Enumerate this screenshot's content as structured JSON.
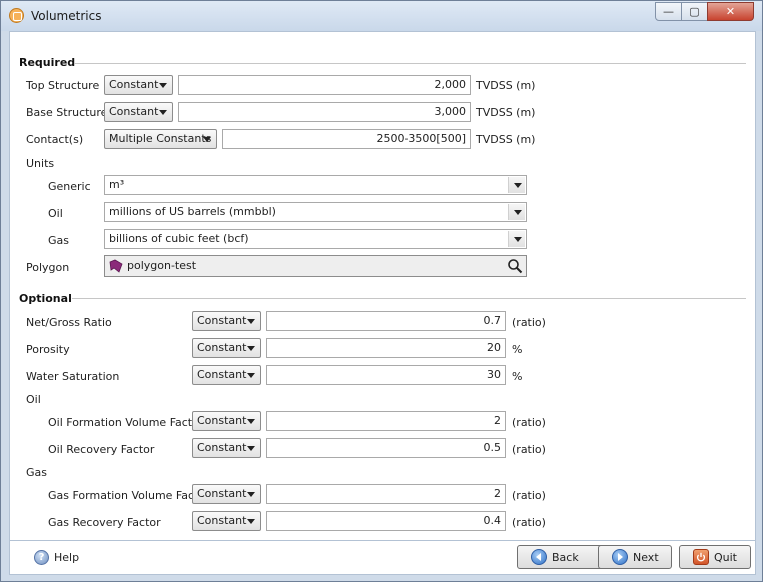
{
  "window": {
    "title": "Volumetrics",
    "min_label": "—",
    "max_label": "▢",
    "close_label": "✕"
  },
  "required": {
    "heading": "Required",
    "top_structure": {
      "label": "Top Structure",
      "mode": "Constant",
      "value": "2,000",
      "unit": "TVDSS (m)"
    },
    "base_structure": {
      "label": "Base Structure",
      "mode": "Constant",
      "value": "3,000",
      "unit": "TVDSS (m)"
    },
    "contacts": {
      "label": "Contact(s)",
      "mode": "Multiple Constants",
      "value": "2500-3500[500]",
      "unit": "TVDSS (m)"
    },
    "units": {
      "label": "Units",
      "generic": {
        "label": "Generic",
        "value": "m³"
      },
      "oil": {
        "label": "Oil",
        "value": "millions of US barrels (mmbbl)"
      },
      "gas": {
        "label": "Gas",
        "value": "billions of cubic feet (bcf)"
      }
    },
    "polygon": {
      "label": "Polygon",
      "value": "polygon-test"
    }
  },
  "optional": {
    "heading": "Optional",
    "net_gross": {
      "label": "Net/Gross Ratio",
      "mode": "Constant",
      "value": "0.7",
      "unit": "(ratio)"
    },
    "porosity": {
      "label": "Porosity",
      "mode": "Constant",
      "value": "20",
      "unit": "%"
    },
    "water_saturation": {
      "label": "Water Saturation",
      "mode": "Constant",
      "value": "30",
      "unit": "%"
    },
    "oil_label": "Oil",
    "oil_fvf": {
      "label": "Oil Formation Volume Factor",
      "mode": "Constant",
      "value": "2",
      "unit": "(ratio)"
    },
    "oil_rf": {
      "label": "Oil Recovery Factor",
      "mode": "Constant",
      "value": "0.5",
      "unit": "(ratio)"
    },
    "gas_label": "Gas",
    "gas_fvf": {
      "label": "Gas Formation Volume Factor",
      "mode": "Constant",
      "value": "2",
      "unit": "(ratio)"
    },
    "gas_rf": {
      "label": "Gas Recovery Factor",
      "mode": "Constant",
      "value": "0.4",
      "unit": "(ratio)"
    }
  },
  "footer": {
    "help": "Help",
    "help_glyph": "?",
    "back": "Back",
    "next": "Next",
    "quit": "Quit"
  }
}
